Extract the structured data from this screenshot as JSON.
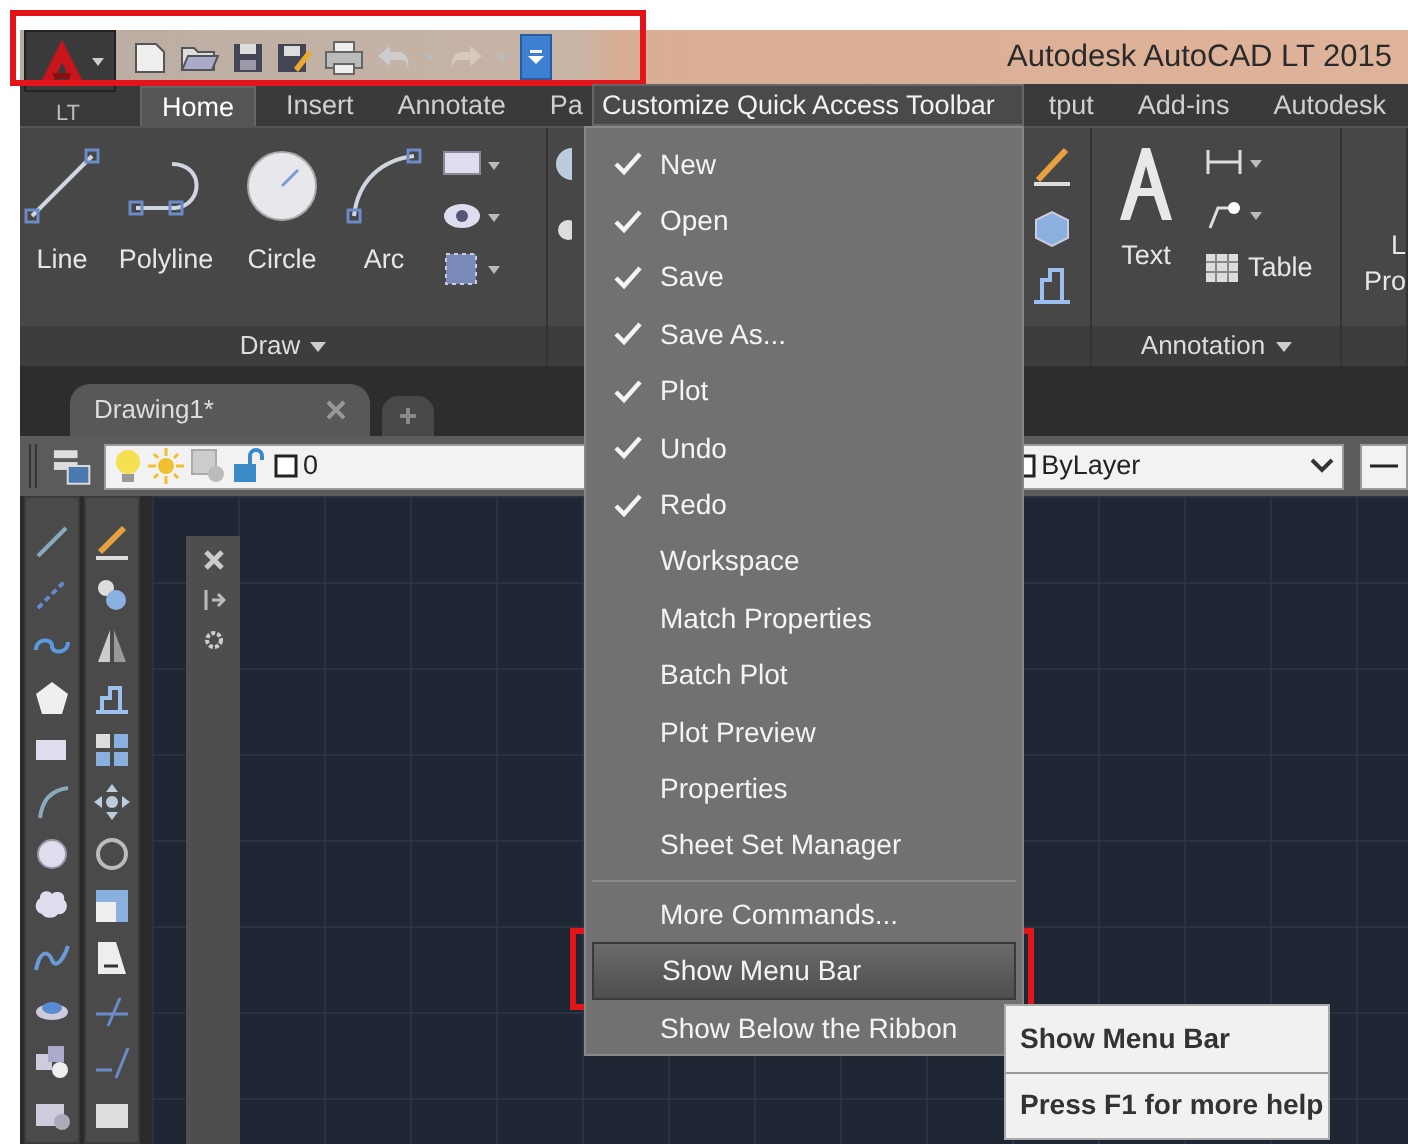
{
  "window": {
    "title": "Autodesk AutoCAD LT 2015"
  },
  "app_button": {
    "label": "LT"
  },
  "quick_access": {
    "highlighted": true,
    "customize_open": true
  },
  "ribbon_tabs_left": [
    {
      "label": "Home",
      "selected": true
    },
    {
      "label": "Insert",
      "selected": false
    },
    {
      "label": "Annotate",
      "selected": false
    },
    {
      "label": "Pa",
      "selected": false
    }
  ],
  "ribbon_tabs_right": [
    {
      "label": "tput",
      "selected": false
    },
    {
      "label": "Add-ins",
      "selected": false
    },
    {
      "label": "Autodesk",
      "selected": false
    }
  ],
  "draw_panel": {
    "title": "Draw",
    "tools": [
      {
        "label": "Line",
        "kind": "line"
      },
      {
        "label": "Polyline",
        "kind": "polyline"
      },
      {
        "label": "Circle",
        "kind": "circle"
      },
      {
        "label": "Arc",
        "kind": "arc"
      }
    ]
  },
  "annotation_panel": {
    "title": "Annotation",
    "text_tool": "Text",
    "table_tool": "Table"
  },
  "cut_panel": {
    "labels": [
      "L",
      "Pro"
    ]
  },
  "document_tabs": [
    {
      "label": "Drawing1*",
      "selected": true
    }
  ],
  "layer_bar": {
    "layer": "0",
    "color_setting": "ByLayer"
  },
  "menu": {
    "title": "Customize Quick Access Toolbar",
    "items": [
      {
        "label": "New",
        "checked": true,
        "selected": false
      },
      {
        "label": "Open",
        "checked": true,
        "selected": false
      },
      {
        "label": "Save",
        "checked": true,
        "selected": false
      },
      {
        "label": "Save As...",
        "checked": true,
        "selected": false
      },
      {
        "label": "Plot",
        "checked": true,
        "selected": false
      },
      {
        "label": "Undo",
        "checked": true,
        "selected": false
      },
      {
        "label": "Redo",
        "checked": true,
        "selected": false
      },
      {
        "label": "Workspace",
        "checked": false,
        "selected": false
      },
      {
        "label": "Match Properties",
        "checked": false,
        "selected": false
      },
      {
        "label": "Batch Plot",
        "checked": false,
        "selected": false
      },
      {
        "label": "Plot Preview",
        "checked": false,
        "selected": false
      },
      {
        "label": "Properties",
        "checked": false,
        "selected": false
      },
      {
        "label": "Sheet Set Manager",
        "checked": false,
        "selected": false
      },
      {
        "label": "More Commands...",
        "separator_before": true,
        "checked": false,
        "selected": false,
        "highlighted": false
      },
      {
        "label": "Show Menu Bar",
        "checked": false,
        "selected": true,
        "highlighted": true
      },
      {
        "label": "Show Below the Ribbon",
        "checked": false,
        "selected": false,
        "highlighted": false
      }
    ]
  },
  "tooltip": {
    "title": "Show Menu Bar",
    "help": "Press F1 for more help"
  }
}
